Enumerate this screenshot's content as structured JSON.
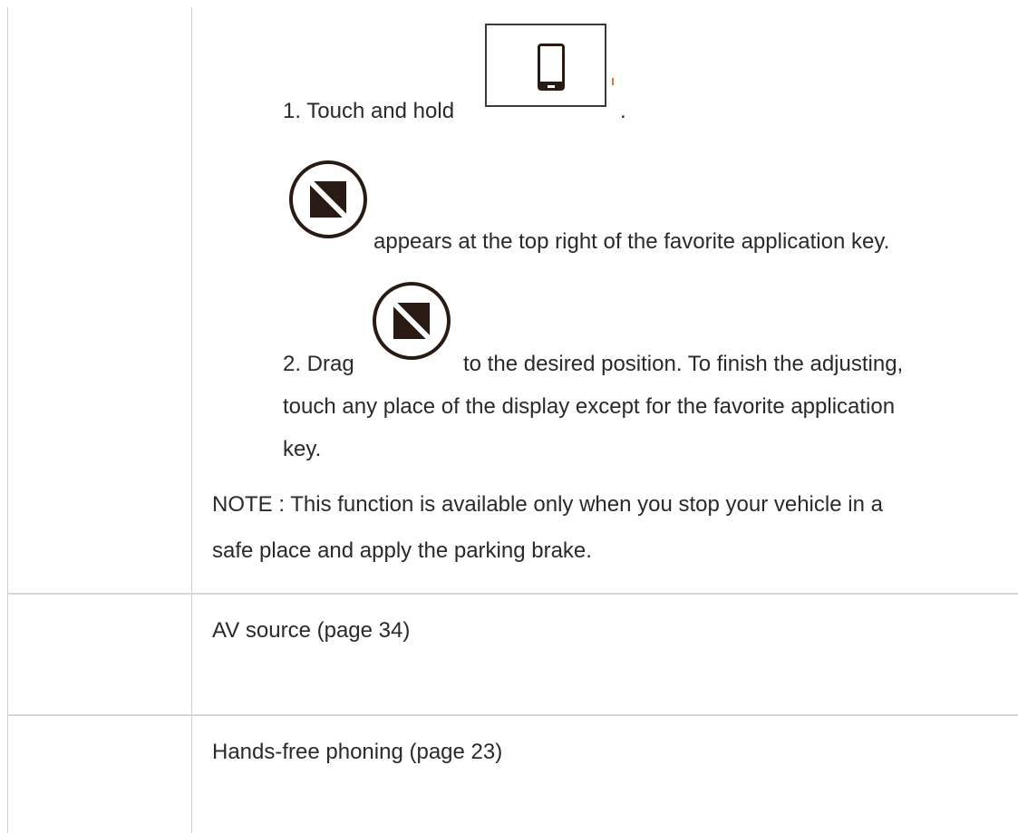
{
  "step1": {
    "prefix": "1. Touch and hold",
    "suffix": "."
  },
  "appears_text": "appears at the top right of the favorite application key.",
  "step2": {
    "prefix": "2. Drag",
    "line1_rest": "to the desired position. To finish the adjusting,",
    "line2": "touch any place of the display except for the favorite application",
    "line3": "key."
  },
  "note": {
    "line1": "NOTE : This function is available only when you stop your vehicle in a",
    "line2": "safe place and apply the parking brake."
  },
  "rows": [
    {
      "text": "AV source (page 34)"
    },
    {
      "text": "Hands-free phoning (page 23)"
    }
  ],
  "icons": {
    "phone_key": "smartphone-key-icon",
    "adjust": "adjust-position-icon"
  },
  "colors": {
    "text": "#2a2a2a",
    "border": "#cfcfcf",
    "accent": "#e07a20"
  }
}
